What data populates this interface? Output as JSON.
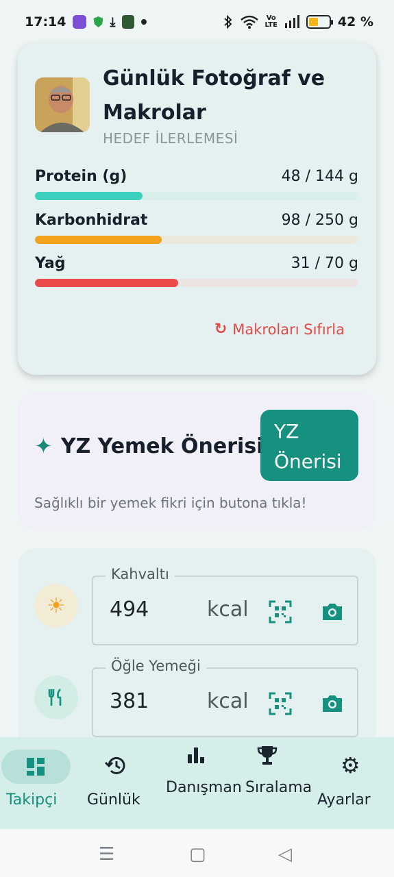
{
  "status_bar": {
    "time": "17:14",
    "volte": "Vo\nLTE",
    "battery": "42 %"
  },
  "goal_card": {
    "title_line1": "Günlük Fotoğraf ve",
    "title_line2": "Makrolar",
    "subtitle": "HEDEF İLERLEMESİ",
    "macros": [
      {
        "label": "Protein (g)",
        "value": "48 / 144 g",
        "progress": 0.333,
        "color": "#3ccfbd",
        "track": "#d8efec"
      },
      {
        "label": "Karbonhidrat",
        "value": "98 / 250 g",
        "progress": 0.392,
        "color": "#f2a21c",
        "track": "#ece9dc"
      },
      {
        "label": "Yağ",
        "value": "31 / 70 g",
        "progress": 0.443,
        "color": "#ea4a4a",
        "track": "#ebe4e2"
      }
    ],
    "reset_label": "Makroları Sıfırla",
    "reset_icon": "refresh-icon"
  },
  "ai_card": {
    "title": "YZ Yemek Önerisi",
    "button_line1": "YZ",
    "button_line2": "Önerisi",
    "hint": "Sağlıklı bir yemek fikri için butona tıkla!"
  },
  "meals": [
    {
      "label": "Kahvaltı",
      "value": "494",
      "unit": "kcal",
      "icon": "sun-icon",
      "icon_bg": "#f2ecd7",
      "icon_color": "#f2a21c"
    },
    {
      "label": "Öğle Yemeği",
      "value": "381",
      "unit": "kcal",
      "icon": "fork-knife-icon",
      "icon_bg": "#d2ece6",
      "icon_color": "#16907f"
    }
  ],
  "bottom_nav": {
    "items": [
      {
        "label": "Takipçi",
        "icon": "dashboard-icon",
        "active": true
      },
      {
        "label": "Günlük",
        "icon": "history-icon",
        "active": false
      },
      {
        "label": "Danışman",
        "icon": "bar-chart-icon",
        "active": false
      },
      {
        "label": "Sıralama",
        "icon": "trophy-icon",
        "active": false
      },
      {
        "label": "Ayarlar",
        "icon": "gear-icon",
        "active": false
      }
    ]
  },
  "colors": {
    "accent": "#16907f",
    "active_nav_text": "#16907f",
    "reset": "#e04a48"
  }
}
